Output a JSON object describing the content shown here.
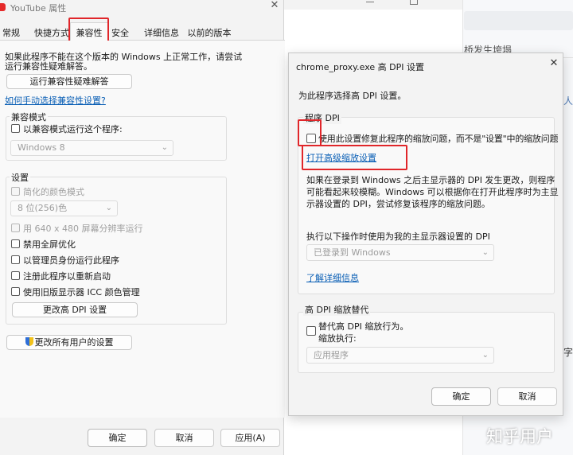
{
  "colors": {
    "accent_red": "#e0262a",
    "link_blue": "#0a5fb5"
  },
  "left_window": {
    "title": "YouTube 属性",
    "tabs": [
      "常规",
      "快捷方式",
      "兼容性",
      "安全",
      "详细信息",
      "以前的版本"
    ],
    "intro": [
      "如果此程序不能在这个版本的 Windows 上正常工作，请尝试",
      "运行兼容性疑难解答。"
    ],
    "troubleshoot_button": "运行兼容性疑难解答",
    "manual_link": "如何手动选择兼容性设置?",
    "compat_mode": {
      "title": "兼容模式",
      "checkbox_label": "以兼容模式运行这个程序:",
      "os_select": "Windows 8"
    },
    "settings": {
      "title": "设置",
      "reduced_color": "简化的颜色模式",
      "color_select": "8 位(256)色",
      "resolution_640": "用 640 x 480 屏幕分辨率运行",
      "disable_fullscreen": "禁用全屏优化",
      "run_as_admin": "以管理员身份运行此程序",
      "register_restart": "注册此程序以重新启动",
      "legacy_icc": "使用旧版显示器 ICC 颜色管理",
      "high_dpi_button": "更改高 DPI 设置"
    },
    "all_users_button": "更改所有用户的设置",
    "ok": "确定",
    "cancel": "取消",
    "apply": "应用(A)"
  },
  "bg_window": {
    "headline": "桥发生垮塌",
    "side_char_1": "人",
    "side_char_2": "字"
  },
  "dpi_dialog": {
    "title": "chrome_proxy.exe 高 DPI 设置",
    "subtitle": "为此程序选择高 DPI 设置。",
    "program_dpi": {
      "title": "程序 DPI",
      "checkbox_label": "使用此设置修复此程序的缩放问题，而不是\"设置\"中的缩放问题",
      "open_scaling_link": "打开高级缩放设置",
      "description": [
        "如果在登录到 Windows 之后主显示器的 DPI 发生更改，则程序",
        "可能看起来较模糊。Windows 可以根据你在打开此程序时为主显",
        "示器设置的 DPI，尝试修复该程序的缩放问题。"
      ],
      "execute_label": "执行以下操作时使用为我的主显示器设置的 DPI",
      "execute_select": "已登录到 Windows",
      "learn_more": "了解详细信息"
    },
    "override": {
      "title": "高 DPI 缩放替代",
      "checkbox_label": "替代高 DPI 缩放行为。",
      "performed_by": "缩放执行:",
      "performed_select": "应用程序"
    },
    "ok": "确定",
    "cancel": "取消"
  },
  "watermark": "知乎用户"
}
